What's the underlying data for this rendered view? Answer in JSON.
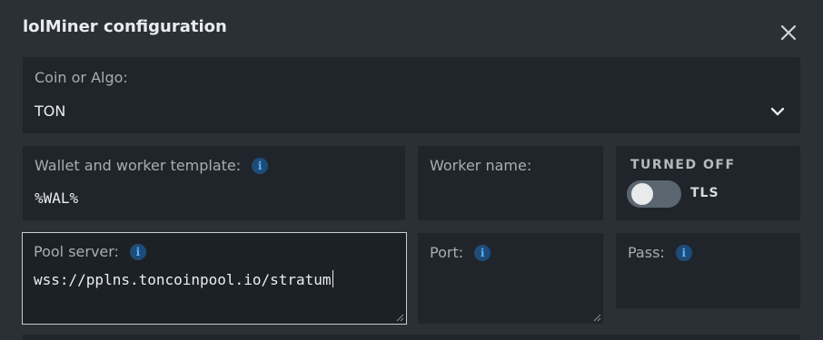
{
  "dialog": {
    "title": "lolMiner configuration",
    "close_icon": "close-icon"
  },
  "coin_algo": {
    "label": "Coin or Algo:",
    "selected": "TON",
    "icon": "chevron-down-icon"
  },
  "wallet_template": {
    "label": "Wallet and worker template:",
    "value": "%WAL%",
    "icon": "info-icon"
  },
  "worker_name": {
    "label": "Worker name:",
    "value": ""
  },
  "tls": {
    "state_label": "TURNED OFF",
    "toggle_label": "TLS",
    "enabled": false
  },
  "pool_server": {
    "label": "Pool server:",
    "value": "wss://pplns.toncoinpool.io/stratum",
    "icon": "info-icon"
  },
  "port": {
    "label": "Port:",
    "value": "",
    "icon": "info-icon"
  },
  "pass": {
    "label": "Pass:",
    "value": "",
    "icon": "info-icon"
  },
  "info_glyph": "i",
  "colors": {
    "background": "#2b3036",
    "field_bg": "#20252b",
    "info_accent": "#5ab2ff"
  }
}
